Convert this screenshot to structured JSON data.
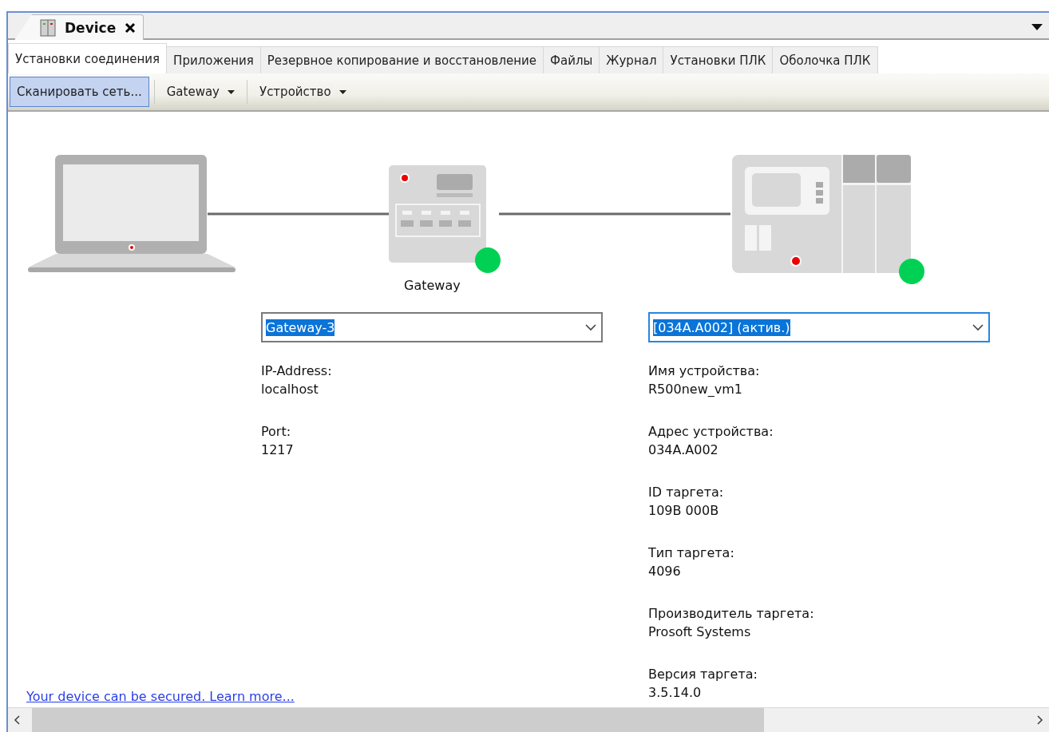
{
  "document_tab": {
    "title": "Device",
    "selected": true
  },
  "tabs": [
    {
      "label": "Установки соединения",
      "selected": true
    },
    {
      "label": "Приложения",
      "selected": false
    },
    {
      "label": "Резервное копирование и восстановление",
      "selected": false
    },
    {
      "label": "Файлы",
      "selected": false
    },
    {
      "label": "Журнал",
      "selected": false
    },
    {
      "label": "Установки ПЛК",
      "selected": false
    },
    {
      "label": "Оболочка ПЛК",
      "selected": false
    }
  ],
  "toolbar": [
    {
      "label": "Сканировать сеть...",
      "kind": "button",
      "selected": true
    },
    {
      "label": "Gateway",
      "kind": "dropdown",
      "selected": false
    },
    {
      "label": "Устройство",
      "kind": "dropdown",
      "selected": false
    }
  ],
  "diagram": {
    "gateway": {
      "label": "Gateway",
      "color": "#00d154"
    },
    "device": {
      "color": "#00d154"
    }
  },
  "gateway_panel": {
    "selection": "Gateway-3",
    "highlighted": true,
    "focused": false,
    "fields": [
      {
        "label": "IP-Address:",
        "value": "localhost"
      },
      {
        "label": "Port:",
        "value": "1217"
      }
    ]
  },
  "device_panel": {
    "selection": "[034A.A002] (актив.)",
    "highlighted": true,
    "focused": true,
    "fields": [
      {
        "label": "Имя устройства:",
        "value": "R500new_vm1"
      },
      {
        "label": "Адрес устройства:",
        "value": "034A.A002"
      },
      {
        "label": "ID таргета:",
        "value": "109B 000B"
      },
      {
        "label": "Тип таргета:",
        "value": "4096"
      },
      {
        "label": "Производитель таргета:",
        "value": "Prosoft Systems"
      },
      {
        "label": "Версия таргета:",
        "value": "3.5.14.0"
      }
    ]
  },
  "footer_link": "Your device can be secured. Learn more..."
}
